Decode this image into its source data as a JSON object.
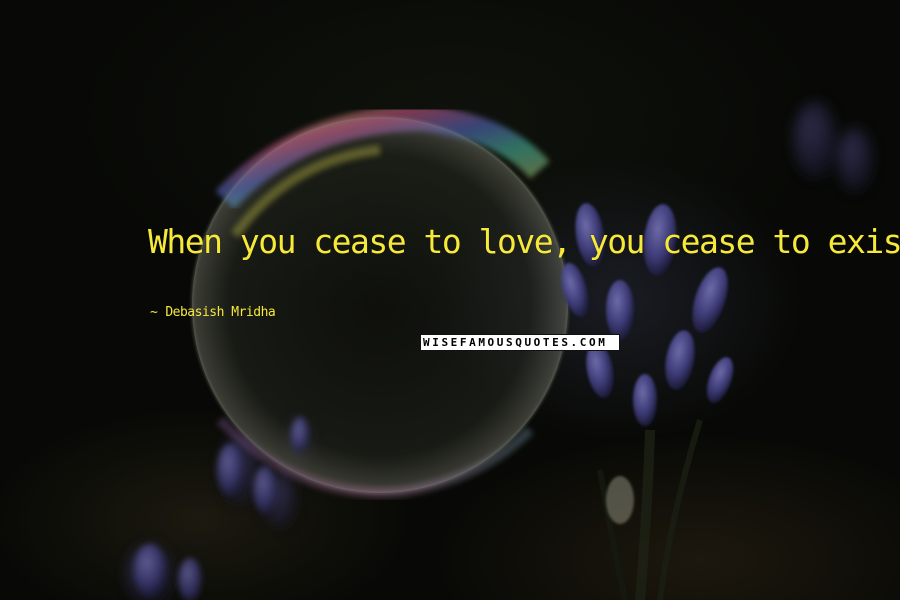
{
  "quote": {
    "text": "When you cease to love, you cease to exist.",
    "author_dash": "~",
    "author": "Debasish Mridha"
  },
  "watermark": {
    "text": "WISEFAMOUSQUOTES.COM"
  },
  "colors": {
    "quote_text": "#f6e93a",
    "background": "#080906",
    "watermark_bg": "#ffffff"
  },
  "background_objects": [
    "soap-bubble",
    "purple-flower-buds"
  ]
}
